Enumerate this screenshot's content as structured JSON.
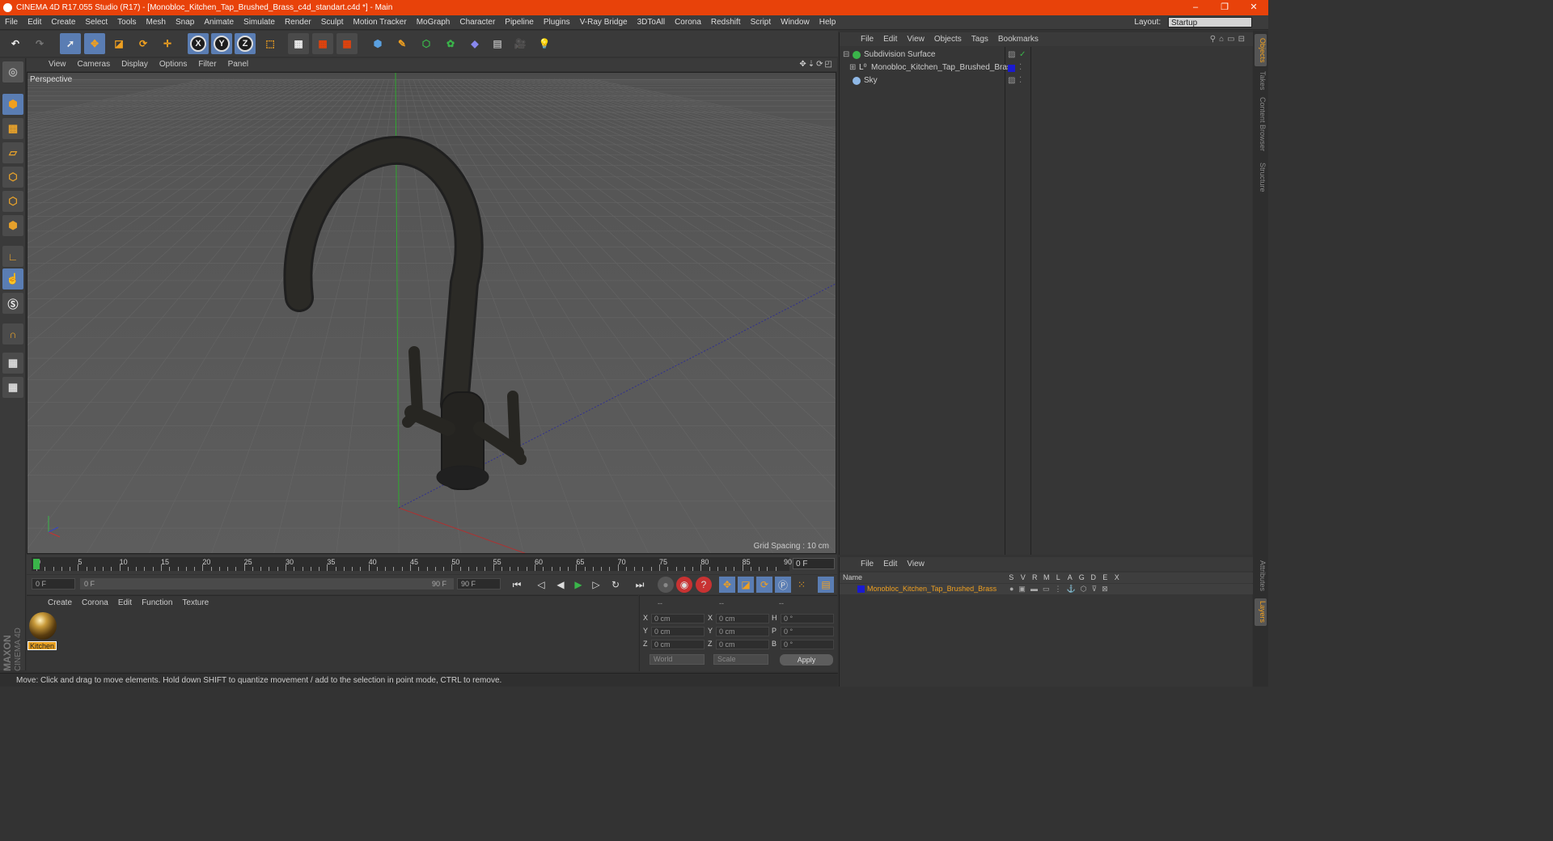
{
  "title_bar": {
    "title": "CINEMA 4D R17.055 Studio (R17) - [Monobloc_Kitchen_Tap_Brushed_Brass_c4d_standart.c4d *] - Main",
    "minimize": "–",
    "restore": "❐",
    "close": "✕"
  },
  "menu": [
    "File",
    "Edit",
    "Create",
    "Select",
    "Tools",
    "Mesh",
    "Snap",
    "Animate",
    "Simulate",
    "Render",
    "Sculpt",
    "Motion Tracker",
    "MoGraph",
    "Character",
    "Pipeline",
    "Plugins",
    "V-Ray Bridge",
    "3DToAll",
    "Corona",
    "Redshift",
    "Script",
    "Window",
    "Help"
  ],
  "layout": {
    "label": "Layout:",
    "value": "Startup"
  },
  "toolbar": {
    "x": "X",
    "y": "Y",
    "z": "Z"
  },
  "viewport_menu": [
    "View",
    "Cameras",
    "Display",
    "Options",
    "Filter",
    "Panel"
  ],
  "viewport": {
    "label": "Perspective",
    "grid_spacing": "Grid Spacing : 10 cm"
  },
  "timeline": {
    "ticks": [
      "0",
      "5",
      "10",
      "15",
      "20",
      "25",
      "30",
      "35",
      "40",
      "45",
      "50",
      "55",
      "60",
      "65",
      "70",
      "75",
      "80",
      "85",
      "90"
    ],
    "current_frame": "0 F"
  },
  "transport": {
    "start": "0 F",
    "range_start": "0 F",
    "range_end": "90 F",
    "end": "90 F"
  },
  "material_menu": [
    "Create",
    "Corona",
    "Edit",
    "Function",
    "Texture"
  ],
  "material": {
    "name": "Kitchen"
  },
  "coords": {
    "headers": [
      "--",
      "--",
      "--"
    ],
    "rows": [
      {
        "l1": "X",
        "v1": "0 cm",
        "l2": "X",
        "v2": "0 cm",
        "l3": "H",
        "v3": "0 °"
      },
      {
        "l1": "Y",
        "v1": "0 cm",
        "l2": "Y",
        "v2": "0 cm",
        "l3": "P",
        "v3": "0 °"
      },
      {
        "l1": "Z",
        "v1": "0 cm",
        "l2": "Z",
        "v2": "0 cm",
        "l3": "B",
        "v3": "0 °"
      }
    ],
    "space": "World",
    "mode": "Scale",
    "apply": "Apply"
  },
  "status": "Move: Click and drag to move elements. Hold down SHIFT to quantize movement / add to the selection in point mode, CTRL to remove.",
  "brand": {
    "line1": "MAXON",
    "line2": "CINEMA 4D"
  },
  "object_manager": {
    "menu": [
      "File",
      "Edit",
      "View",
      "Objects",
      "Tags",
      "Bookmarks"
    ],
    "objects": [
      {
        "name": "Subdivision Surface",
        "icon_color": "#3ab54a"
      },
      {
        "name": "Monobloc_Kitchen_Tap_Brushed_Brass",
        "icon_color": "#1a1ad0"
      },
      {
        "name": "Sky",
        "icon_color": "#8fb8e6"
      }
    ]
  },
  "layer_manager": {
    "menu": [
      "File",
      "Edit",
      "View"
    ],
    "name_header": "Name",
    "columns": [
      "S",
      "V",
      "R",
      "M",
      "L",
      "A",
      "G",
      "D",
      "E",
      "X"
    ],
    "layer_name": "Monobloc_Kitchen_Tap_Brushed_Brass",
    "layer_color": "#1a1ad0"
  },
  "right_tabs": [
    "Objects",
    "Takes",
    "Content Browser",
    "Structure",
    "Attributes",
    "Layers"
  ],
  "colors": {
    "accent": "#e8420a",
    "highlight": "#f0a020",
    "active_tool": "#5a7db3"
  }
}
